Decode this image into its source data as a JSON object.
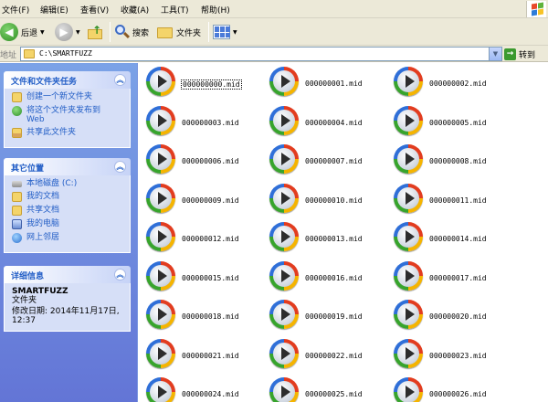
{
  "menu": [
    "文件(F)",
    "编辑(E)",
    "查看(V)",
    "收藏(A)",
    "工具(T)",
    "帮助(H)"
  ],
  "toolbar": {
    "back_label": "后退",
    "search_label": "搜索",
    "folders_label": "文件夹"
  },
  "address": {
    "label": "地址",
    "path": "C:\\SMARTFUZZ",
    "go_label": "转到"
  },
  "tasks_panel": {
    "title": "文件和文件夹任务",
    "items": [
      {
        "label": "创建一个新文件夹",
        "icon": "new-folder-icon"
      },
      {
        "label": "将这个文件夹发布到 Web",
        "icon": "publish-web-icon"
      },
      {
        "label": "共享此文件夹",
        "icon": "share-folder-icon"
      }
    ]
  },
  "places_panel": {
    "title": "其它位置",
    "items": [
      {
        "label": "本地磁盘 (C:)",
        "icon": "local-disk-icon"
      },
      {
        "label": "我的文档",
        "icon": "my-documents-icon"
      },
      {
        "label": "共享文档",
        "icon": "shared-documents-icon"
      },
      {
        "label": "我的电脑",
        "icon": "my-computer-icon"
      },
      {
        "label": "网上邻居",
        "icon": "network-places-icon"
      }
    ]
  },
  "details_panel": {
    "title": "详细信息",
    "name": "SMARTFUZZ",
    "type": "文件夹",
    "modified": "修改日期: 2014年11月17日, 12:37"
  },
  "files": [
    "000000000.mid",
    "000000001.mid",
    "000000002.mid",
    "000000003.mid",
    "000000004.mid",
    "000000005.mid",
    "000000006.mid",
    "000000007.mid",
    "000000008.mid",
    "000000009.mid",
    "000000010.mid",
    "000000011.mid",
    "000000012.mid",
    "000000013.mid",
    "000000014.mid",
    "000000015.mid",
    "000000016.mid",
    "000000017.mid",
    "000000018.mid",
    "000000019.mid",
    "000000020.mid",
    "000000021.mid",
    "000000022.mid",
    "000000023.mid",
    "000000024.mid",
    "000000025.mid",
    "000000026.mid"
  ],
  "selected_file_index": 0,
  "colors": {
    "taskpane_gradient_top": "#7ba2e7",
    "taskpane_gradient_bottom": "#6375d6",
    "panel_title": "#215dc6",
    "chrome": "#ece9d8"
  }
}
